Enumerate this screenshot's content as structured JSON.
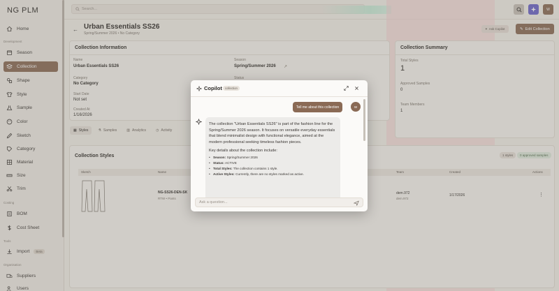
{
  "app": {
    "logo": "NG PLM"
  },
  "sidebar": {
    "sections": {
      "development": "Development",
      "costing": "Costing",
      "tools": "Tools",
      "organisation": "Organisation"
    },
    "items": [
      {
        "label": "Home",
        "icon": "home-icon"
      },
      {
        "label": "Season",
        "icon": "calendar-icon"
      },
      {
        "label": "Collection",
        "icon": "layers-icon",
        "active": true
      },
      {
        "label": "Shape",
        "icon": "shapes-icon"
      },
      {
        "label": "Style",
        "icon": "shirt-icon"
      },
      {
        "label": "Sample",
        "icon": "flask-icon"
      },
      {
        "label": "Color",
        "icon": "palette-icon"
      },
      {
        "label": "Sketch",
        "icon": "sketch-icon"
      },
      {
        "label": "Category",
        "icon": "tag-icon"
      },
      {
        "label": "Material",
        "icon": "material-icon"
      },
      {
        "label": "Size",
        "icon": "ruler-icon"
      },
      {
        "label": "Trim",
        "icon": "scissors-icon"
      },
      {
        "label": "BOM",
        "icon": "bom-icon"
      },
      {
        "label": "Cost Sheet",
        "icon": "dollar-icon"
      },
      {
        "label": "Import",
        "icon": "import-icon",
        "badge": "Beta"
      },
      {
        "label": "Suppliers",
        "icon": "truck-icon"
      },
      {
        "label": "Users",
        "icon": "users-icon"
      }
    ]
  },
  "topbar": {
    "search_placeholder": "Search..."
  },
  "header": {
    "title": "Urban Essentials SS26",
    "subtitle": "Spring/Summer 2026 • No Category",
    "ask_copilot": "Ask Copilot",
    "edit_collection": "Edit Collection"
  },
  "info": {
    "title": "Collection Information",
    "name_label": "Name",
    "name_value": "Urban Essentials SS26",
    "season_label": "Season",
    "season_value": "Spring/Summer 2026",
    "category_label": "Category",
    "category_value": "No Category",
    "status_label": "Status",
    "start_label": "Start Date",
    "start_value": "Not set",
    "created_label": "Created At",
    "created_value": "1/16/2026"
  },
  "summary": {
    "title": "Collection Summary",
    "total_styles_label": "Total Styles",
    "total_styles_value": "1",
    "approved_label": "Approved Samples",
    "approved_value": "0",
    "team_label": "Team Members",
    "team_value": "1"
  },
  "tabs": [
    "Styles",
    "Samples",
    "Analytics",
    "Activity"
  ],
  "styles": {
    "title": "Collection Styles",
    "badge_styles": "1 styles",
    "badge_approved": "0 approved samples",
    "columns": [
      "Sketch",
      "Name",
      "Team",
      "Created",
      "Actions"
    ],
    "row": {
      "name": "NG-SS26-DEN-SK",
      "sub": "RTW • Pants",
      "team": "dem.972",
      "team_sub": "dem.972",
      "created": "1/17/2026"
    }
  },
  "copilot": {
    "title": "Copilot",
    "tag": "collection",
    "user_message": "Tell me about this collection",
    "user_initial": "W",
    "response": "The collection \"Urban Essentials SS26\" is part of the fashion line for the Spring/Summer 2026 season. It focuses on versatile everyday essentials that blend minimalist design with functional elegance, aimed at the modern professional seeking timeless fashion pieces.",
    "details_lead": "Key details about the collection include:",
    "details": [
      {
        "k": "Season:",
        "v": "Spring/Summer 2026"
      },
      {
        "k": "Status:",
        "v": "ACTIVE"
      },
      {
        "k": "Total Styles:",
        "v": "The collection contains 1 style."
      },
      {
        "k": "Active Styles:",
        "v": "Currently, there are no styles marked as active."
      }
    ],
    "input_placeholder": "Ask a question..."
  },
  "colors": {
    "accent": "#8a6a55",
    "bg": "#f3efe9"
  }
}
